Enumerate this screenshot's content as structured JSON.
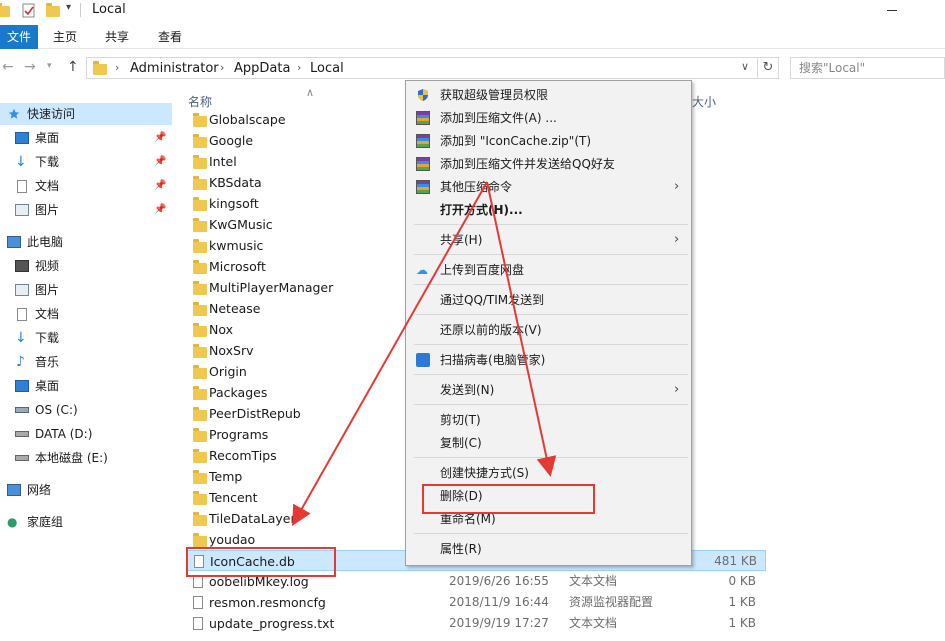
{
  "window": {
    "title": "Local"
  },
  "ribbon": {
    "tabs": [
      "文件",
      "主页",
      "共享",
      "查看"
    ]
  },
  "address": {
    "crumbs": [
      "Administrator",
      "AppData",
      "Local"
    ],
    "search_placeholder": "搜索\"Local\""
  },
  "sidebar": {
    "quick_access": "快速访问",
    "quick_items": [
      "桌面",
      "下载",
      "文档",
      "图片"
    ],
    "this_pc": "此电脑",
    "pc_items": [
      "视频",
      "图片",
      "文档",
      "下载",
      "音乐",
      "桌面",
      "OS (C:)",
      "DATA (D:)",
      "本地磁盘 (E:)"
    ],
    "network": "网络",
    "homegroup": "家庭组"
  },
  "filelist": {
    "col_name": "名称",
    "col_size": "大小",
    "folders": [
      "Globalscape",
      "Google",
      "Intel",
      "KBSdata",
      "kingsoft",
      "KwGMusic",
      "kwmusic",
      "Microsoft",
      "MultiPlayerManager",
      "Netease",
      "Nox",
      "NoxSrv",
      "Origin",
      "Packages",
      "PeerDistRepub",
      "Programs",
      "RecomTips",
      "Temp",
      "Tencent",
      "TileDataLayer",
      "youdao"
    ],
    "files": [
      {
        "name": "IconCache.db",
        "date": "",
        "type": "",
        "size": "481 KB"
      },
      {
        "name": "oobelibMkey.log",
        "date": "2019/6/26 16:55",
        "type": "文本文档",
        "size": "0 KB"
      },
      {
        "name": "resmon.resmoncfg",
        "date": "2018/11/9 16:44",
        "type": "资源监视器配置",
        "size": "1 KB"
      },
      {
        "name": "update_progress.txt",
        "date": "2019/9/19 17:27",
        "type": "文本文档",
        "size": "1 KB"
      }
    ]
  },
  "context_menu": {
    "items": [
      "获取超级管理员权限",
      "添加到压缩文件(A) ...",
      "添加到 \"IconCache.zip\"(T)",
      "添加到压缩文件并发送给QQ好友",
      "其他压缩命令",
      "打开方式(H)...",
      "共享(H)",
      "上传到百度网盘",
      "通过QQ/TIM发送到",
      "还原以前的版本(V)",
      "扫描病毒(电脑管家)",
      "发送到(N)",
      "剪切(T)",
      "复制(C)",
      "创建快捷方式(S)",
      "删除(D)",
      "重命名(M)",
      "属性(R)"
    ]
  },
  "colors": {
    "accent": "#1979ca",
    "selection": "#cce8ff",
    "annotation": "#e53935",
    "folder": "#f0c850"
  }
}
